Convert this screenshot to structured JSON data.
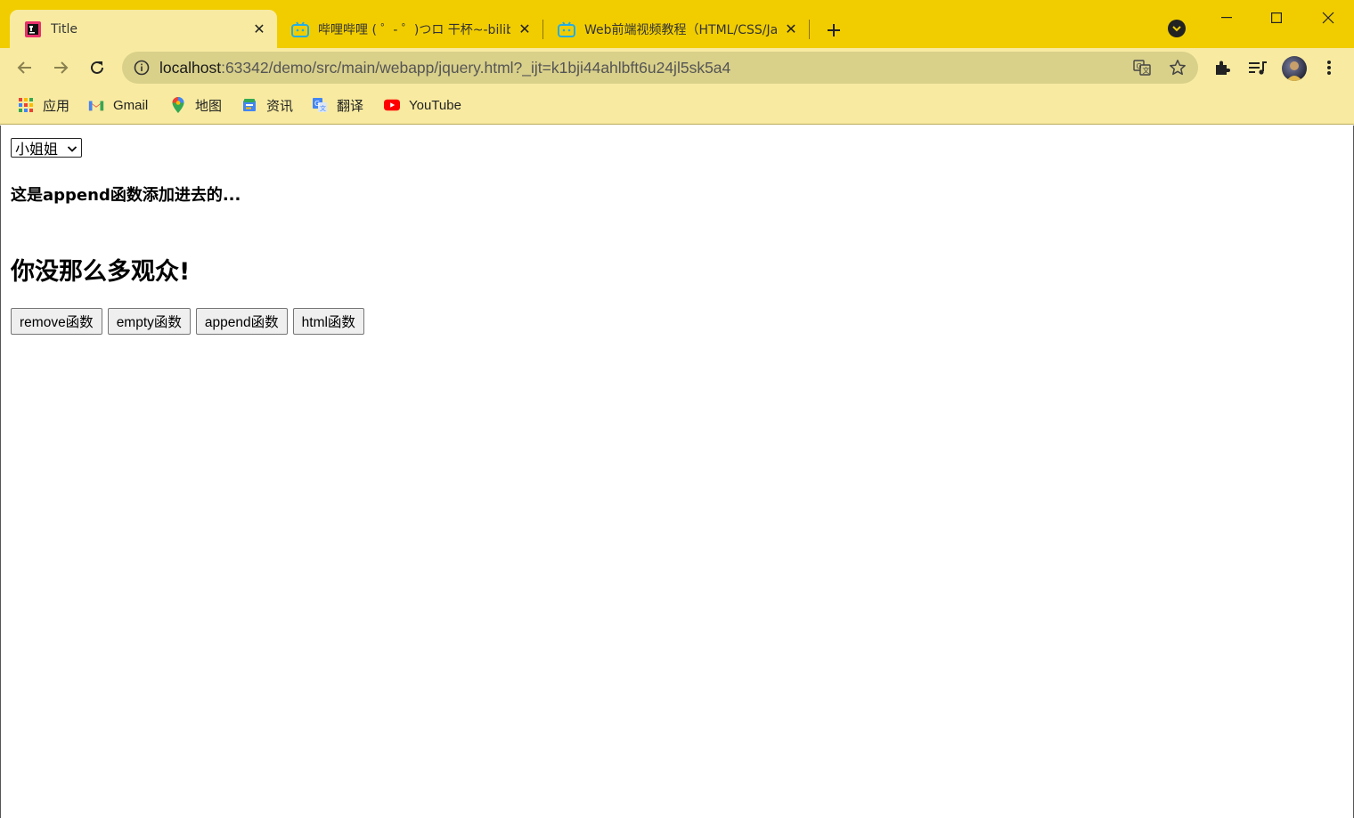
{
  "tabs": [
    {
      "title": "Title",
      "active": true
    },
    {
      "title": "哔哩哔哩 ( ゜- ゜)つロ 干杯~-bilibili",
      "active": false
    },
    {
      "title": "Web前端视频教程（HTML/CSS/JavaScript）",
      "active": false
    }
  ],
  "toolbar": {
    "url_host": "localhost",
    "url_rest": ":63342/demo/src/main/webapp/jquery.html?_ijt=k1bji44ahlbft6u24jl5sk5a4"
  },
  "bookmarks": [
    {
      "label": "应用",
      "icon": "apps-grid-icon"
    },
    {
      "label": "Gmail",
      "icon": "gmail-icon"
    },
    {
      "label": "地图",
      "icon": "maps-pin-icon"
    },
    {
      "label": "资讯",
      "icon": "news-icon"
    },
    {
      "label": "翻译",
      "icon": "translate-icon"
    },
    {
      "label": "YouTube",
      "icon": "youtube-icon"
    }
  ],
  "page": {
    "select_value": "小姐姐",
    "heading_small": "这是append函数添加进去的...",
    "heading_large": "你没那么多观众!",
    "buttons": [
      {
        "label": "remove函数"
      },
      {
        "label": "empty函数"
      },
      {
        "label": "append函数"
      },
      {
        "label": "html函数"
      }
    ]
  },
  "colors": {
    "frame": "#f1cd00",
    "toolbar": "#f8eba1",
    "omnibox": "#d9d08a"
  }
}
